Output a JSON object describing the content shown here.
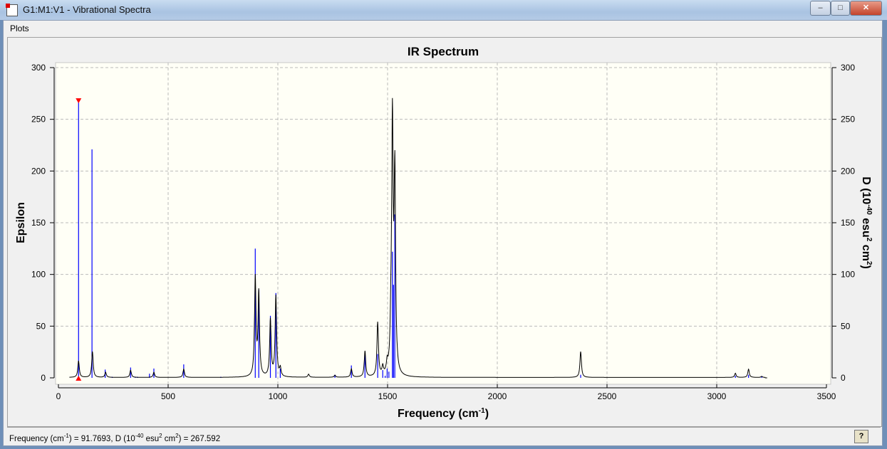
{
  "window": {
    "title": "G1:M1:V1 - Vibrational Spectra",
    "minimize": "–",
    "maximize": "□",
    "close": "✕"
  },
  "menu": {
    "plots": "Plots"
  },
  "status": {
    "prefix": "Frequency (cm",
    "sup1": "-1",
    "mid": ") = 91.7693, D (10",
    "sup2": "-40",
    "mid2": " esu",
    "sup3": "2",
    "mid3": " cm",
    "sup4": "2",
    "suffix": ") = 267.592",
    "help": "?"
  },
  "chart_data": {
    "type": "line",
    "title": "IR Spectrum",
    "xlabel": "Frequency (cm",
    "xlabel_sup": "-1",
    "xlabel_end": ")",
    "ylabel": "Epsilon",
    "y2label": "D (10",
    "y2label_sup": "-40",
    "y2label_mid": " esu",
    "y2label_sup2": "2",
    "y2label_mid2": " cm",
    "y2label_sup3": "2",
    "y2label_end": ")",
    "xlim": [
      0,
      3500
    ],
    "ylim": [
      0,
      300
    ],
    "y2lim": [
      0,
      300
    ],
    "xticks": [
      0,
      500,
      1000,
      1500,
      2000,
      2500,
      3000,
      3500
    ],
    "yticks": [
      0,
      50,
      100,
      150,
      200,
      250,
      300
    ],
    "grid": true,
    "background": "#fffff6",
    "spectrum_color": "#000000",
    "stick_color": "#0000ff",
    "marker_color": "#ff0000",
    "selected_frequency": 91.7693,
    "selected_D": 267.592,
    "spectrum_peaks": {
      "width_hwhm": 4,
      "freq": [
        91.8,
        155,
        215,
        329,
        435,
        571,
        897,
        913,
        966,
        991,
        1011,
        1140,
        1260,
        1335,
        1397,
        1455,
        1478,
        1498,
        1515,
        1522,
        1533,
        2380,
        3085,
        3145,
        3205
      ],
      "epsilon": [
        16,
        25,
        5,
        7,
        5,
        8,
        95,
        80,
        55,
        78,
        8,
        3,
        2,
        8,
        25,
        52,
        8,
        10,
        30,
        240,
        190,
        25,
        4,
        8,
        1
      ]
    },
    "sticks": {
      "freq": [
        91.8,
        153,
        213,
        245,
        329,
        350,
        360,
        415,
        435,
        571,
        740,
        897,
        913,
        966,
        991,
        1011,
        1260,
        1335,
        1397,
        1455,
        1478,
        1489,
        1498,
        1506,
        1522,
        1527,
        1533,
        2380,
        3085,
        3145,
        3205
      ],
      "D": [
        267.6,
        221,
        8,
        1,
        10,
        1,
        1,
        4,
        9,
        13,
        1,
        125,
        85,
        60,
        82,
        9,
        3,
        12,
        23,
        23,
        7.5,
        2,
        9,
        6,
        122,
        90,
        158,
        3,
        2,
        3,
        1
      ]
    }
  }
}
